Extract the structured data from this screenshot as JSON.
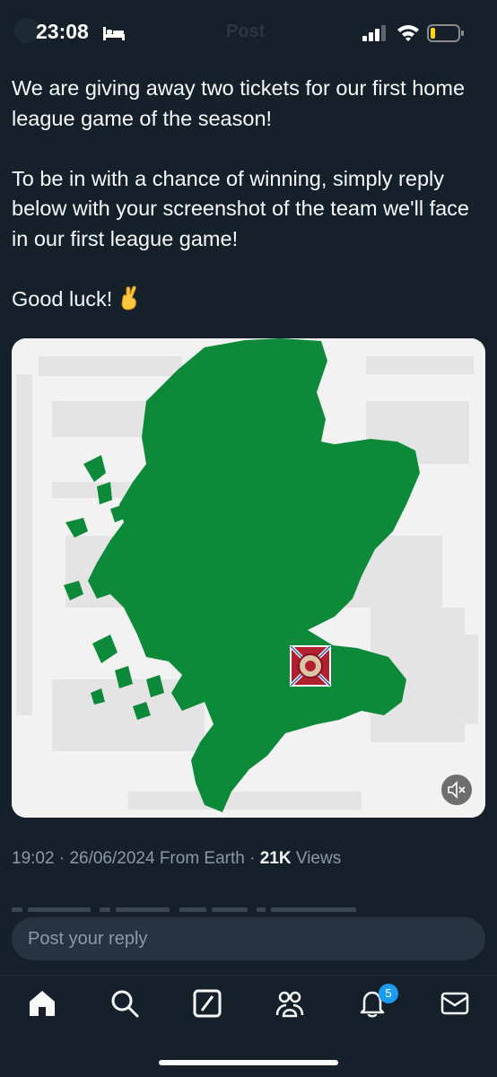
{
  "status_bar": {
    "time": "23:08",
    "faded_title": "Post"
  },
  "tweet": {
    "paragraphs": [
      "We are giving away two tickets for our first home league game of the season!",
      "To be in with a chance of winning, simply reply below with your screenshot of the team we'll face in our first league game!",
      "Good luck!"
    ],
    "emoji": "crossed-fingers-emoji",
    "media": {
      "description_icons": [
        "scotland-map",
        "club-crest",
        "mute-icon"
      ],
      "colors": {
        "map_green": "#0c8a3a",
        "background": "#f2f2f2"
      }
    },
    "meta": {
      "time": "19:02",
      "date": "26/06/2024",
      "source": "From Earth",
      "views_count": "21K",
      "views_label": "Views",
      "separator": "·"
    }
  },
  "reply": {
    "placeholder": "Post your reply"
  },
  "tab_bar": {
    "items": [
      "home-icon",
      "search-icon",
      "grok-icon",
      "communities-icon",
      "notifications-icon",
      "messages-icon"
    ],
    "notification_count": "5"
  },
  "colors": {
    "background": "#15202b",
    "text": "#f7f9f9",
    "secondary_text": "#8b98a5",
    "accent": "#1d9bf0"
  }
}
